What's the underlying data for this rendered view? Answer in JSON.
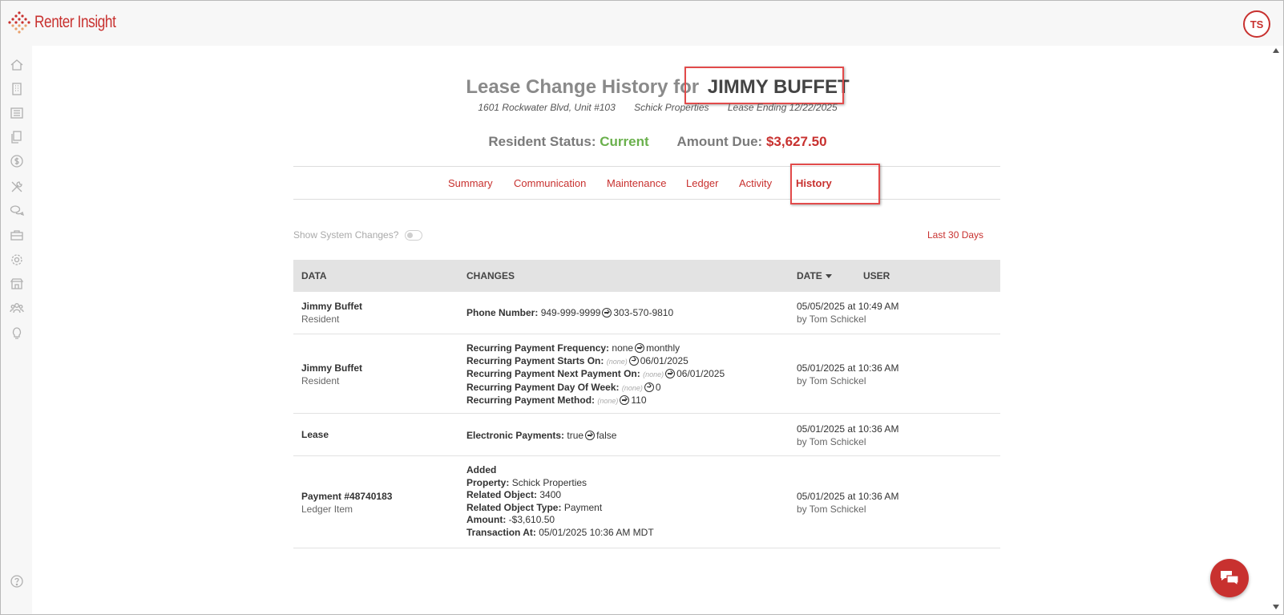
{
  "app": {
    "logo_text": "Renter Insight",
    "user_initials": "TS"
  },
  "sidebar": {
    "items": [
      {
        "icon": "home-icon"
      },
      {
        "icon": "building-icon"
      },
      {
        "icon": "list-icon"
      },
      {
        "icon": "documents-icon"
      },
      {
        "icon": "dollar-icon"
      },
      {
        "icon": "tools-icon"
      },
      {
        "icon": "chat-icon"
      },
      {
        "icon": "briefcase-icon"
      },
      {
        "icon": "gear-icon"
      },
      {
        "icon": "store-icon"
      },
      {
        "icon": "people-icon"
      },
      {
        "icon": "lightbulb-icon"
      }
    ],
    "help_icon": "help-icon"
  },
  "header": {
    "title_prefix": "Lease Change History for",
    "resident_name": "JIMMY BUFFET",
    "address": "1601 Rockwater Blvd, Unit #103",
    "property": "Schick Properties",
    "lease_ending": "Lease Ending 12/22/2025",
    "status_label": "Resident Status:",
    "status_value": "Current",
    "amount_label": "Amount Due:",
    "amount_value": "$3,627.50"
  },
  "tabs": [
    {
      "label": "Summary"
    },
    {
      "label": "Communication"
    },
    {
      "label": "Maintenance"
    },
    {
      "label": "Ledger"
    },
    {
      "label": "Activity"
    },
    {
      "label": "History",
      "active": true
    }
  ],
  "filters": {
    "show_system_changes_label": "Show System Changes?",
    "show_system_changes": false,
    "range_label": "Last 30 Days"
  },
  "table": {
    "headers": {
      "data": "DATA",
      "changes": "CHANGES",
      "date": "DATE",
      "user": "USER"
    },
    "rows": [
      {
        "data_title": "Jimmy Buffet",
        "data_sub": "Resident",
        "changes": [
          {
            "label": "Phone Number:",
            "from": "949-999-9999",
            "to": "303-570-9810"
          }
        ],
        "date": "05/05/2025 at 10:49 AM",
        "user": "by Tom Schickel"
      },
      {
        "data_title": "Jimmy Buffet",
        "data_sub": "Resident",
        "changes": [
          {
            "label": "Recurring Payment Frequency:",
            "from": "none",
            "to": "monthly"
          },
          {
            "label": "Recurring Payment Starts On:",
            "from": "(none)",
            "to": "06/01/2025"
          },
          {
            "label": "Recurring Payment Next Payment On:",
            "from": "(none)",
            "to": "06/01/2025"
          },
          {
            "label": "Recurring Payment Day Of Week:",
            "from": "(none)",
            "to": "0"
          },
          {
            "label": "Recurring Payment Method:",
            "from": "(none)",
            "to": "110"
          }
        ],
        "date": "05/01/2025 at 10:36 AM",
        "user": "by Tom Schickel"
      },
      {
        "data_title": "Lease",
        "data_sub": "",
        "changes": [
          {
            "label": "Electronic Payments:",
            "from": "true",
            "to": "false"
          }
        ],
        "date": "05/01/2025 at 10:36 AM",
        "user": "by Tom Schickel"
      },
      {
        "data_title": "Payment #48740183",
        "data_sub": "Ledger Item",
        "added_label": "Added",
        "fields": [
          {
            "label": "Property:",
            "value": "Schick Properties"
          },
          {
            "label": "Related Object:",
            "value": "3400"
          },
          {
            "label": "Related Object Type:",
            "value": "Payment"
          },
          {
            "label": "Amount:",
            "value": "-$3,610.50"
          },
          {
            "label": "Transaction At:",
            "value": "05/01/2025 10:36 AM MDT"
          }
        ],
        "date": "05/01/2025 at 10:36 AM",
        "user": "by Tom Schickel"
      }
    ]
  },
  "colors": {
    "brand": "#c8312f",
    "status_current": "#6ab04c",
    "highlight_box": "#e24b4b"
  }
}
